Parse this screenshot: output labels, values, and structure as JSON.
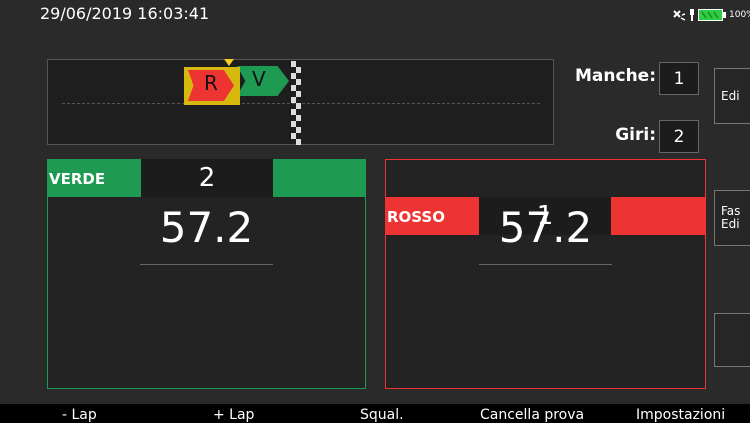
{
  "status": {
    "datetime": "29/06/2019 16:03:41",
    "battery_text": "100%",
    "icons": [
      "satellite-icon",
      "usb-plug-icon",
      "battery-icon"
    ]
  },
  "track": {
    "red_marker_label": "R",
    "green_marker_label": "V"
  },
  "counters": {
    "manche_label": "Manche:",
    "manche_value": "1",
    "giri_label": "Giri:",
    "giri_value": "2"
  },
  "side_buttons": {
    "edit_label": "Edi",
    "fase_line1": "Fas",
    "fase_line2": "Edi"
  },
  "teams": {
    "verde": {
      "name": "VERDE",
      "score": "2",
      "time": "57.2",
      "color": "#1e9a52"
    },
    "rosso": {
      "name": "ROSSO",
      "score": "1",
      "time": "57.2",
      "color": "#ee3333"
    }
  },
  "bottom_bar": {
    "minus_lap": "- Lap",
    "plus_lap": "+ Lap",
    "squal": "Squal.",
    "cancella": "Cancella prova",
    "impostazioni": "Impostazioni"
  }
}
